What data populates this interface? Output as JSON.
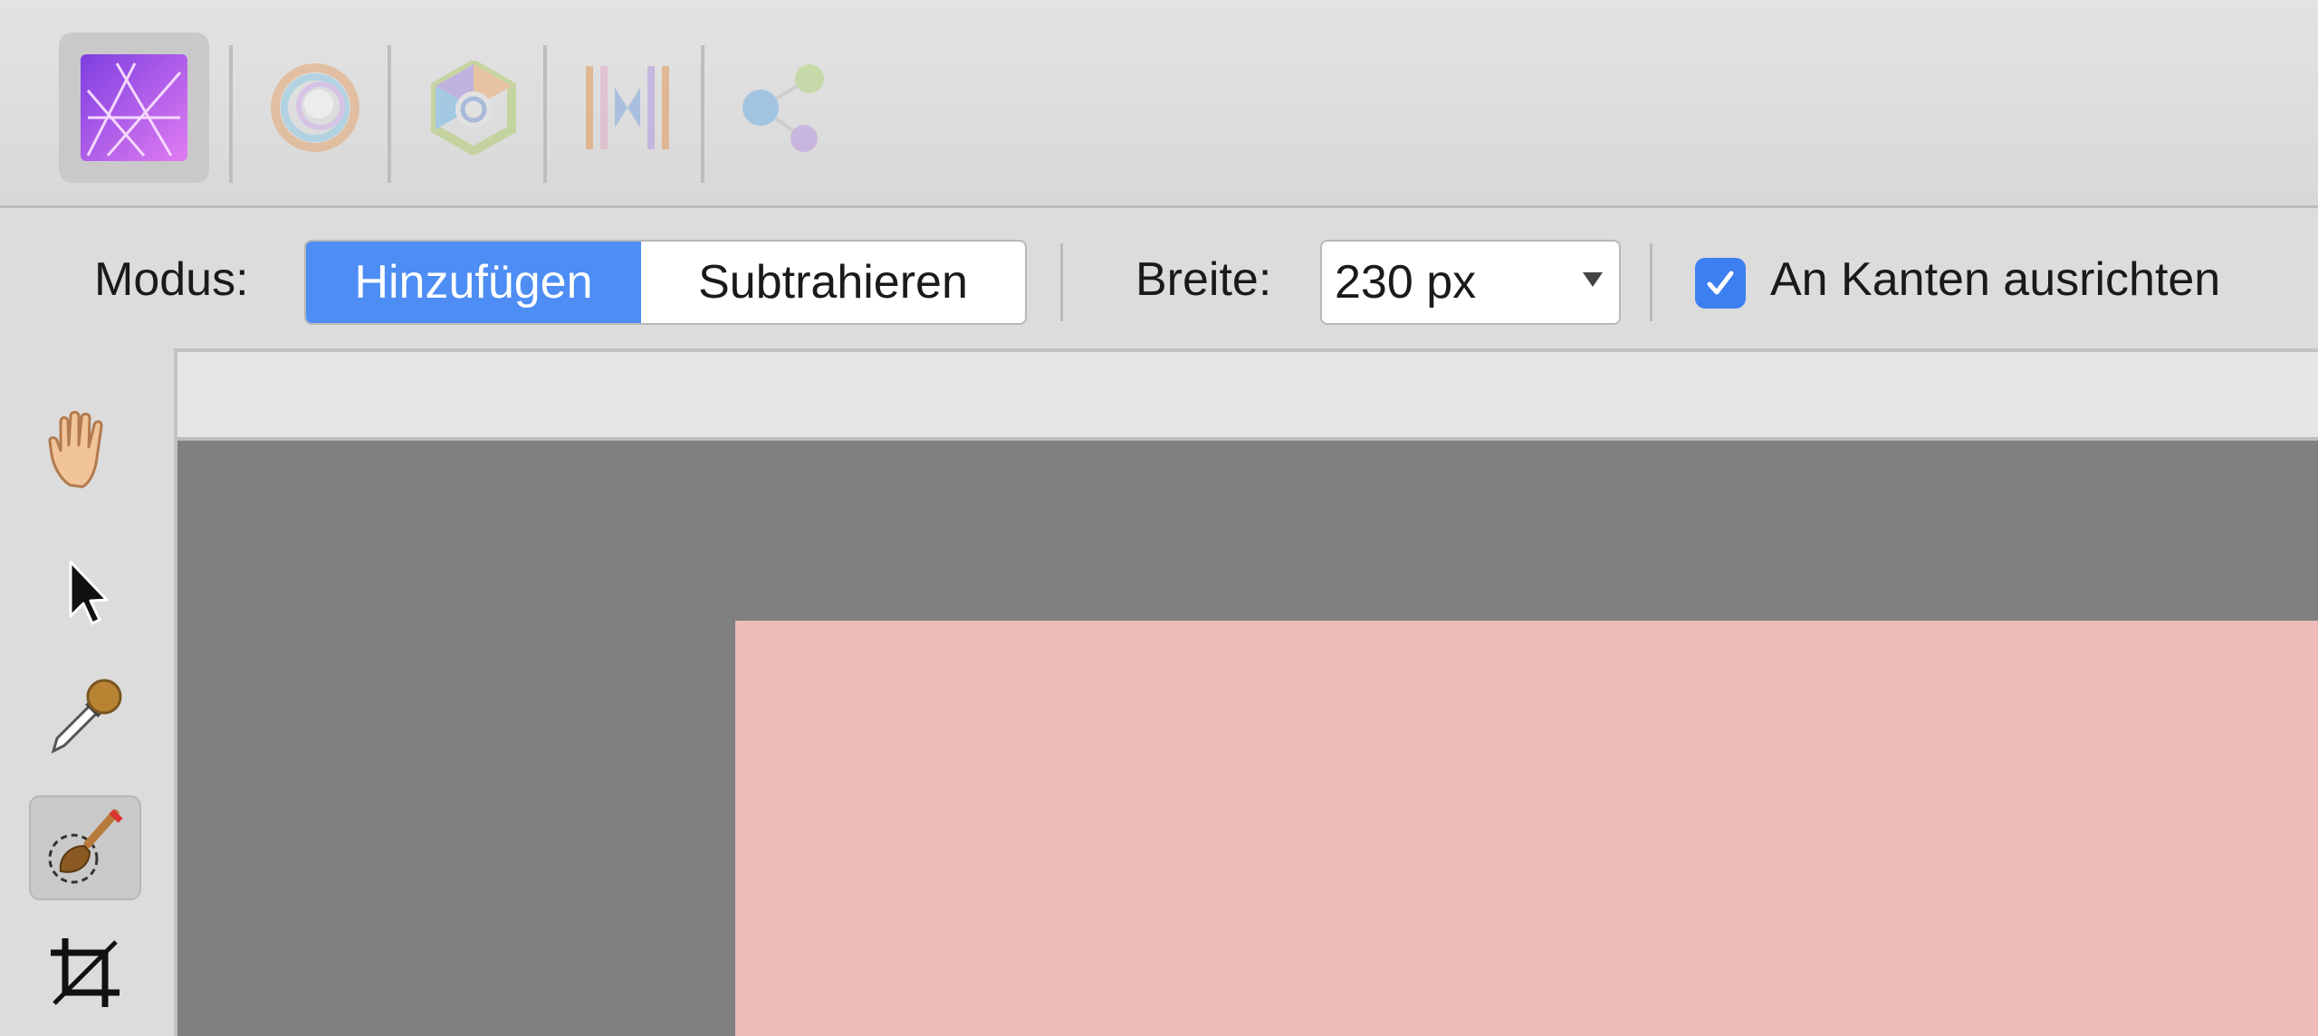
{
  "personas": [
    {
      "name": "Photo",
      "icon": "affinity-photo-persona-icon",
      "active": true
    },
    {
      "name": "Liquify",
      "icon": "liquify-persona-icon",
      "active": false
    },
    {
      "name": "Develop",
      "icon": "develop-persona-icon",
      "active": false
    },
    {
      "name": "Tone Mapping",
      "icon": "tone-mapping-persona-icon",
      "active": false
    },
    {
      "name": "Export",
      "icon": "export-persona-icon",
      "active": false
    }
  ],
  "context_toolbar": {
    "mode_label": "Modus:",
    "mode_options": [
      "Hinzufügen",
      "Subtrahieren"
    ],
    "mode_selected": "Hinzufügen",
    "width_label": "Breite:",
    "width_value": "230 px",
    "snap_label": "An Kanten ausrichten",
    "snap_checked": true
  },
  "tools": [
    {
      "icon": "hand-icon",
      "active": false
    },
    {
      "icon": "move-pointer-icon",
      "active": false
    },
    {
      "icon": "color-picker-icon",
      "active": false
    },
    {
      "icon": "selection-brush-icon",
      "active": true
    },
    {
      "icon": "crop-icon",
      "active": false
    }
  ],
  "colors": {
    "accent": "#4d8df4",
    "checkbox": "#3c7ff0",
    "canvas_background": "#808080",
    "document_fill": "#efbbba"
  }
}
